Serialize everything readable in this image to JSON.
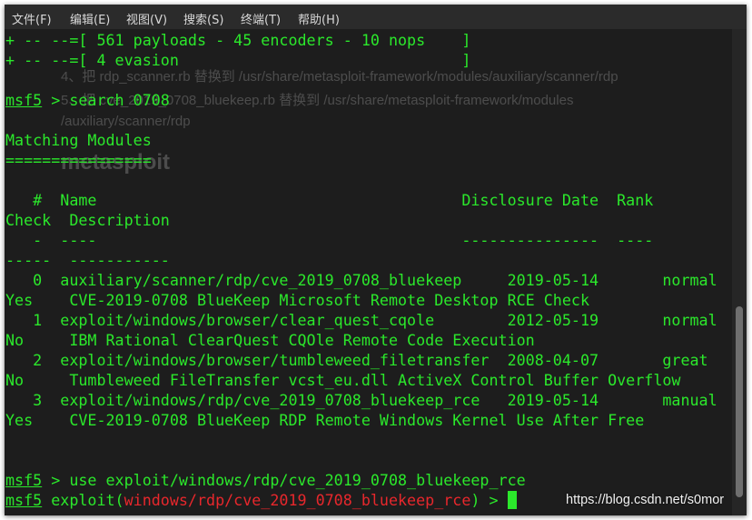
{
  "menu": [
    "文件(F)",
    "编辑(E)",
    "视图(V)",
    "搜索(S)",
    "终端(T)",
    "帮助(H)"
  ],
  "ghost_lines": [
    "4、把 rdp_scanner.rb 替换到 /usr/share/metasploit-framework/modules/auxiliary/scanner/rdp",
    "5、把 cve_2019_0708_bluekeep.rb 替换到 /usr/share/metasploit-framework/modules",
    "/auxiliary/scanner/rdp",
    "metasploit"
  ],
  "terminal": {
    "banner": [
      "+ -- --=[ 561 payloads - 45 encoders - 10 nops    ]",
      "+ -- --=[ 4 evasion                               ]"
    ],
    "prompt": "msf5",
    "prompt_sep": " > ",
    "search_cmd": "search 0708",
    "matching_title": "Matching Modules",
    "matching_rule": "================",
    "header1": "   #  Name                                        Disclosure Date  Rank",
    "header2": "Check  Description",
    "dash1": "   -  ----                                        ---------------  ----",
    "dash2": "-----  -----------",
    "modules": [
      {
        "line": "   0  auxiliary/scanner/rdp/cve_2019_0708_bluekeep     2019-05-14       normal",
        "desc": "Yes    CVE-2019-0708 BlueKeep Microsoft Remote Desktop RCE Check"
      },
      {
        "line": "   1  exploit/windows/browser/clear_quest_cqole        2012-05-19       normal",
        "desc": "No     IBM Rational ClearQuest CQOle Remote Code Execution"
      },
      {
        "line": "   2  exploit/windows/browser/tumbleweed_filetransfer  2008-04-07       great",
        "desc": "No     Tumbleweed FileTransfer vcst_eu.dll ActiveX Control Buffer Overflow"
      },
      {
        "line": "   3  exploit/windows/rdp/cve_2019_0708_bluekeep_rce   2019-05-14       manual",
        "desc": "Yes    CVE-2019-0708 BlueKeep RDP Remote Windows Kernel Use After Free"
      }
    ],
    "use_cmd": "use exploit/windows/rdp/cve_2019_0708_bluekeep_rce",
    "exploit_word": "exploit(",
    "module_path": "windows/rdp/cve_2019_0708_bluekeep_rce",
    "close_paren": ")",
    "end_sep": " > "
  },
  "watermark": "https://blog.csdn.net/s0mor",
  "colors": {
    "terminal_text": "#2be82b",
    "module_path": "#e8272c",
    "background": "#1d1d1d"
  }
}
